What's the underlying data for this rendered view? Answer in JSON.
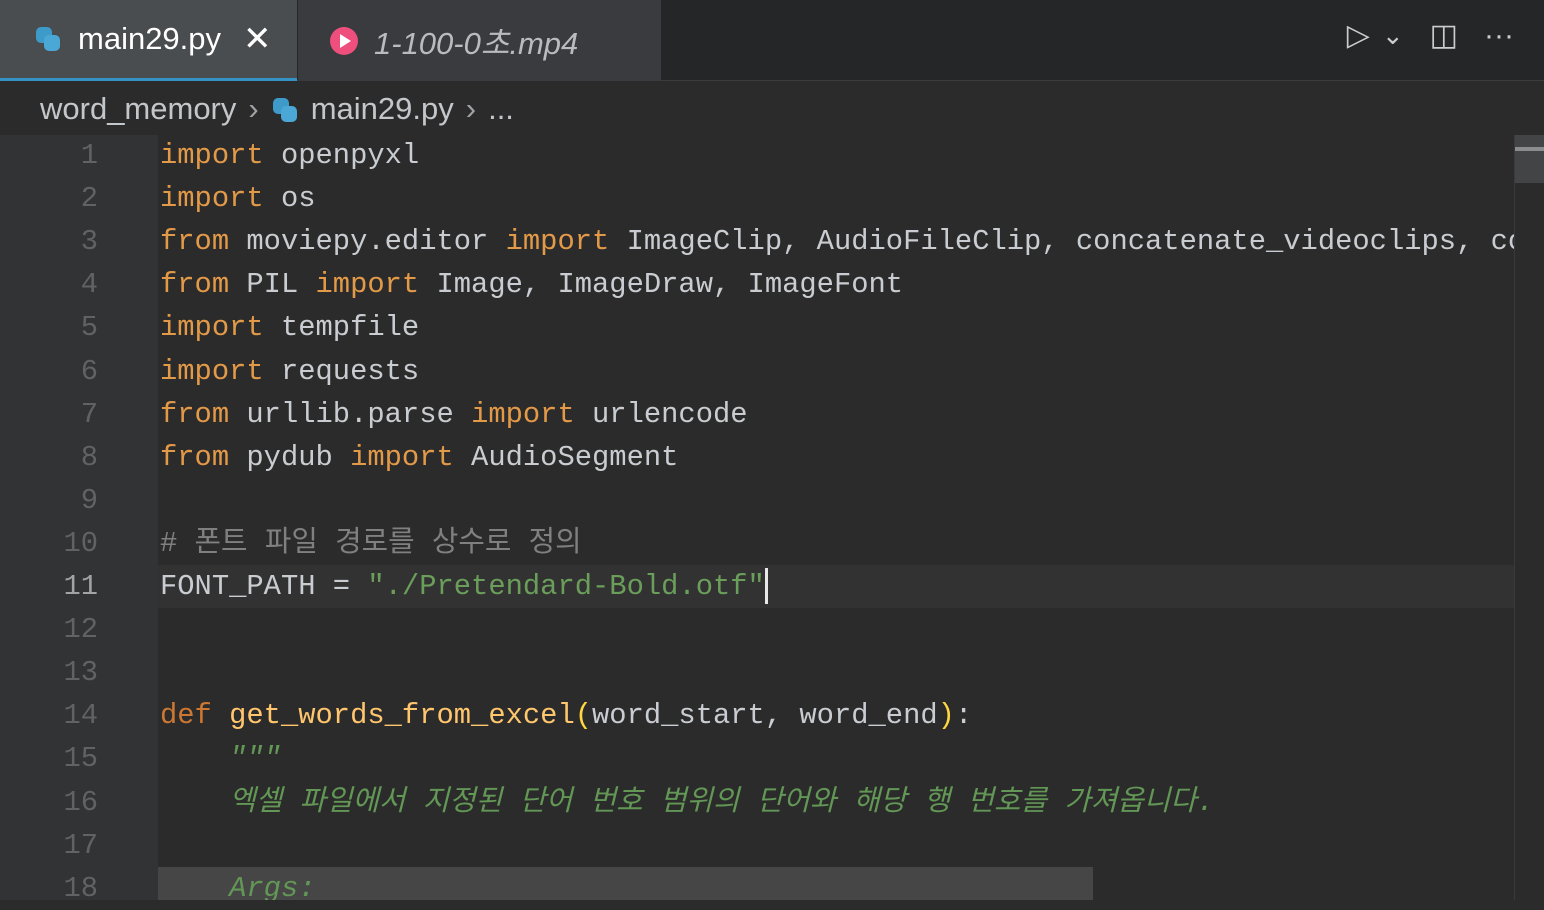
{
  "tabs": [
    {
      "label": "main29.py",
      "icon": "python-icon",
      "active": true
    },
    {
      "label": "1-100-0초.mp4",
      "icon": "play-circle-icon",
      "active": false
    }
  ],
  "breadcrumb": {
    "folder": "word_memory",
    "file": "main29.py",
    "more": "..."
  },
  "actions": {
    "run": "▷",
    "run_menu": "⌄",
    "split": "◫",
    "more": "···"
  },
  "current_line": 11,
  "lines": [
    [
      [
        "kw",
        "import"
      ],
      [
        "id",
        " openpyxl"
      ]
    ],
    [
      [
        "kw",
        "import"
      ],
      [
        "id",
        " os"
      ]
    ],
    [
      [
        "kw",
        "from"
      ],
      [
        "id",
        " moviepy.editor "
      ],
      [
        "kw",
        "import"
      ],
      [
        "id",
        " ImageClip, AudioFileClip, concatenate_videoclips, con"
      ]
    ],
    [
      [
        "kw",
        "from"
      ],
      [
        "id",
        " PIL "
      ],
      [
        "kw",
        "import"
      ],
      [
        "id",
        " Image, ImageDraw, ImageFont"
      ]
    ],
    [
      [
        "kw",
        "import"
      ],
      [
        "id",
        " tempfile"
      ]
    ],
    [
      [
        "kw",
        "import"
      ],
      [
        "id",
        " requests"
      ]
    ],
    [
      [
        "kw",
        "from"
      ],
      [
        "id",
        " urllib.parse "
      ],
      [
        "kw",
        "import"
      ],
      [
        "id",
        " urlencode"
      ]
    ],
    [
      [
        "kw",
        "from"
      ],
      [
        "id",
        " pydub "
      ],
      [
        "kw",
        "import"
      ],
      [
        "id",
        " AudioSegment"
      ]
    ],
    [],
    [
      [
        "cm",
        "# 폰트 파일 경로를 상수로 정의"
      ]
    ],
    [
      [
        "id",
        "FONT_PATH = "
      ],
      [
        "str",
        "\"./Pretendard-Bold.otf\""
      ]
    ],
    [],
    [],
    [
      [
        "def",
        "def"
      ],
      [
        "id",
        " "
      ],
      [
        "fn",
        "get_words_from_excel"
      ],
      [
        "par",
        "("
      ],
      [
        "id",
        "word_start, word_end"
      ],
      [
        "par",
        ")"
      ],
      [
        "id",
        ":"
      ]
    ],
    [
      [
        "doc",
        "    \"\"\""
      ]
    ],
    [
      [
        "doc",
        "    엑셀 파일에서 지정된 단어 번호 범위의 단어와 해당 행 번호를 가져옵니다."
      ]
    ],
    [],
    [
      [
        "doc",
        "    Args:"
      ]
    ]
  ]
}
